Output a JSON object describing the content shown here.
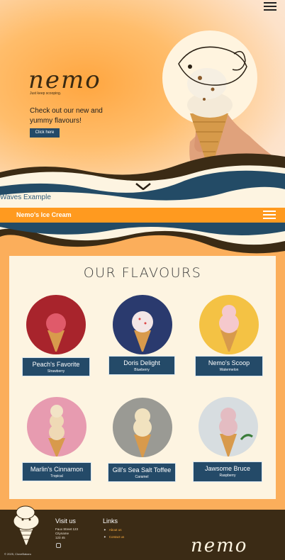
{
  "hero": {
    "logo": "nemo",
    "tagline": "Just keep scooping.",
    "text": "Check out our new and yummy flavours!",
    "button": "Click here",
    "waves_label": "Waves Example"
  },
  "bar": {
    "title": "Nemo's Ice Cream"
  },
  "flavours": {
    "title": "OUR FLAVOURS",
    "items": [
      {
        "name": "Peach's Favorite",
        "sub": "Strawberry",
        "scoop": "#e05a6a",
        "bg": "#a8242c"
      },
      {
        "name": "Doris Delight",
        "sub": "Blueberry",
        "scoop": "#f3e6e6",
        "bg": "#2a3a6e"
      },
      {
        "name": "Nemo's Scoop",
        "sub": "Watermelon",
        "scoop": "#f5c9cd",
        "bg": "#f4c244"
      },
      {
        "name": "Marlin's Cinnamon",
        "sub": "Tropical",
        "scoop": "#efd9b5",
        "bg": "#e79bb0"
      },
      {
        "name": "Gill's Sea Salt Toffee",
        "sub": "Caramel",
        "scoop": "#f1e2bf",
        "bg": "#9a9a94"
      },
      {
        "name": "Jawsome Bruce",
        "sub": "Raspberry",
        "scoop": "#e4bcc2",
        "bg": "#d7dde0"
      }
    ]
  },
  "footer": {
    "visit_title": "Visit us",
    "address": [
      "Faux Street 123",
      "Cityname",
      "123 45"
    ],
    "links_title": "Links",
    "links": [
      "About us",
      "Contact us"
    ],
    "copyright": "© 2025, CloveBakaru",
    "logo": "nemo"
  },
  "colors": {
    "accent": "#ff9a1f",
    "navy": "#244a68",
    "brown": "#3b2b15",
    "cream": "#fdf4e1"
  }
}
